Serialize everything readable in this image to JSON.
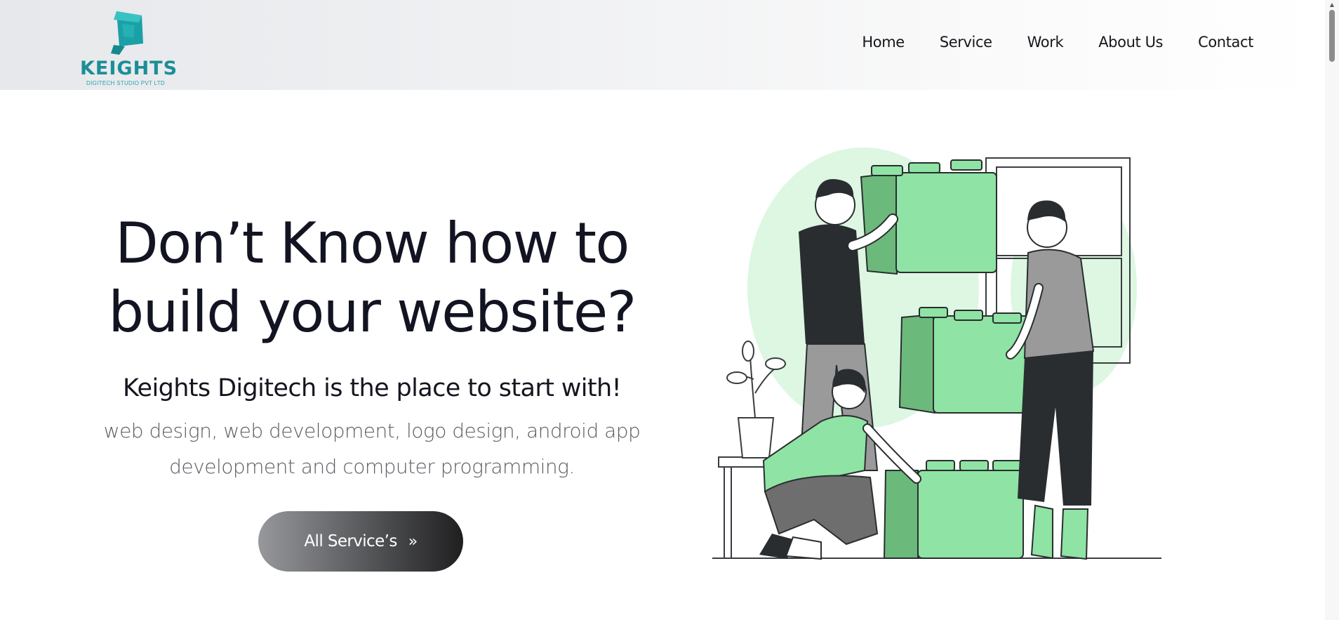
{
  "brand": {
    "name": "KEIGHTS",
    "tagline": "DIGITECH STUDIO PVT LTD",
    "color": "#1b8e97",
    "logo_icon": "teal-cube-icon"
  },
  "nav": {
    "items": [
      "Home",
      "Service",
      "Work",
      "About Us",
      "Contact"
    ]
  },
  "hero": {
    "title_line1": "Don’t Know how to",
    "title_line2": "build your website?",
    "subtitle": "Keights Digitech is the place to start with!",
    "description_line1": "web design, web development, logo design, android app",
    "description_line2": "development and computer programming.",
    "cta_label": "All Service’s",
    "cta_icon": "double-chevron-right-icon"
  },
  "illustration": {
    "subject": "team-building-blocks-illustration",
    "accent_color": "#8fe3a4",
    "dark_color": "#2a2d30"
  }
}
